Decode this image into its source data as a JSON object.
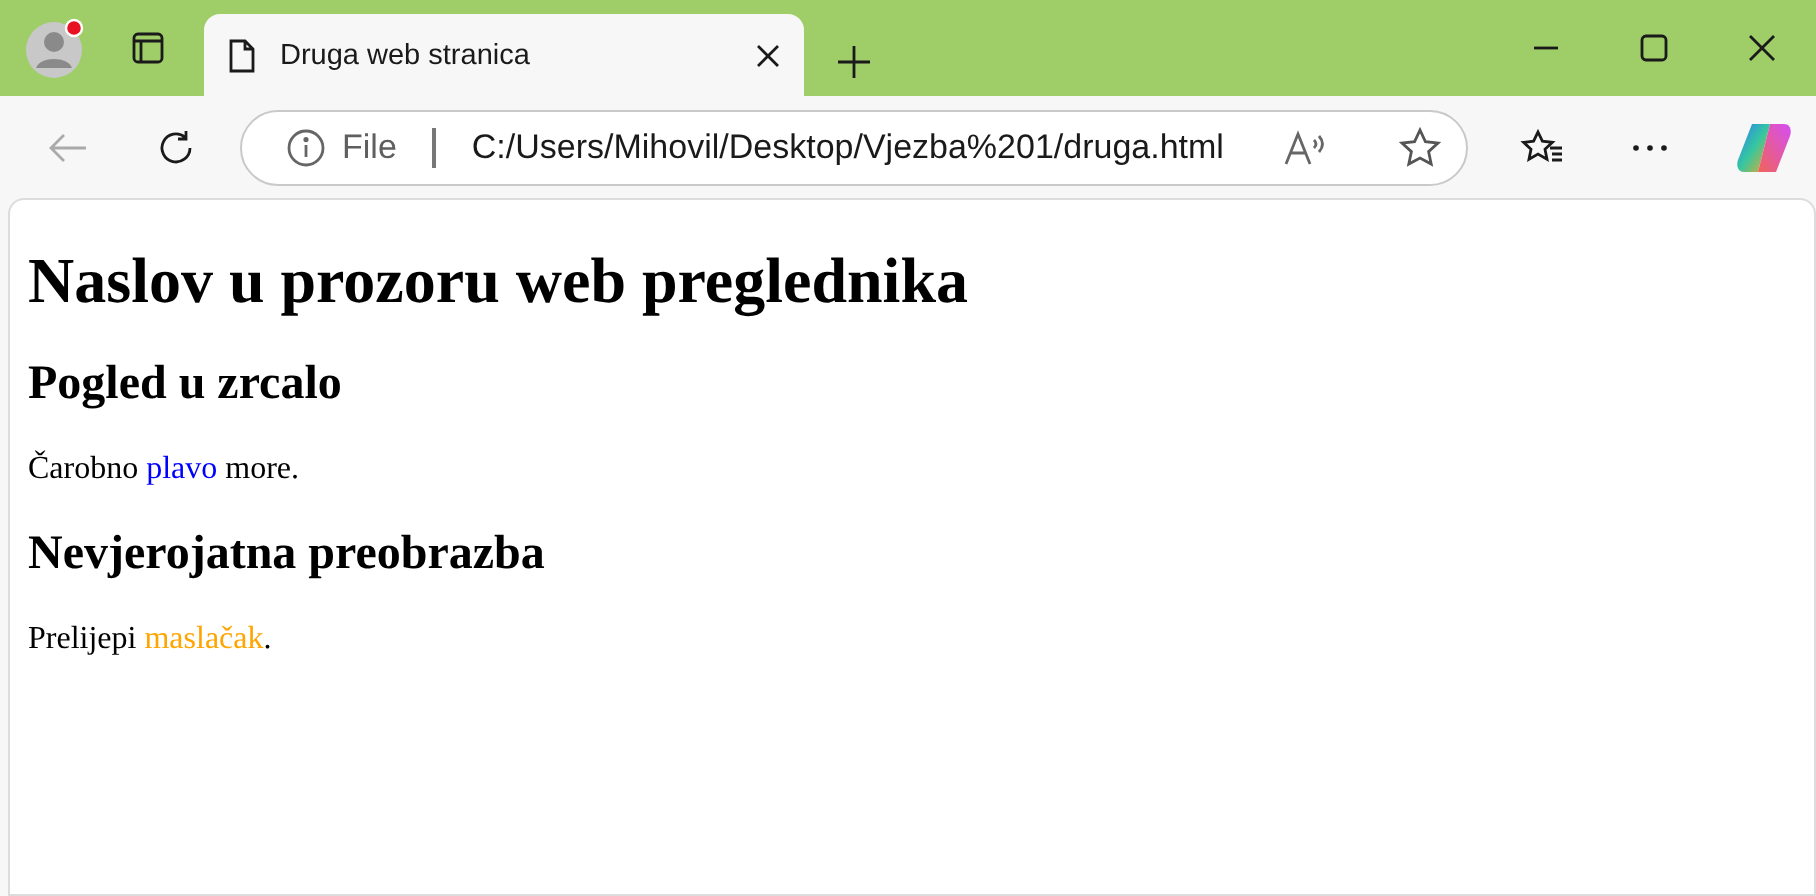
{
  "tab": {
    "title": "Druga web stranica",
    "selected": true
  },
  "address_bar": {
    "scheme": "File",
    "url": "C:/Users/Mihovil/Desktop/Vjezba%201/druga.html"
  },
  "page": {
    "title": "Naslov u prozoru web preglednika",
    "sections": [
      {
        "heading": "Pogled u zrcalo",
        "paragraph": [
          {
            "text": "Čarobno ",
            "color": "#000000"
          },
          {
            "text": "plavo",
            "color": "#0000ff"
          },
          {
            "text": " more.",
            "color": "#000000"
          }
        ]
      },
      {
        "heading": "Nevjerojatna preobrazba",
        "paragraph": [
          {
            "text": "Prelijepi ",
            "color": "#000000"
          },
          {
            "text": "maslačak",
            "color": "#ffa500"
          },
          {
            "text": ".",
            "color": "#000000"
          }
        ]
      }
    ]
  }
}
